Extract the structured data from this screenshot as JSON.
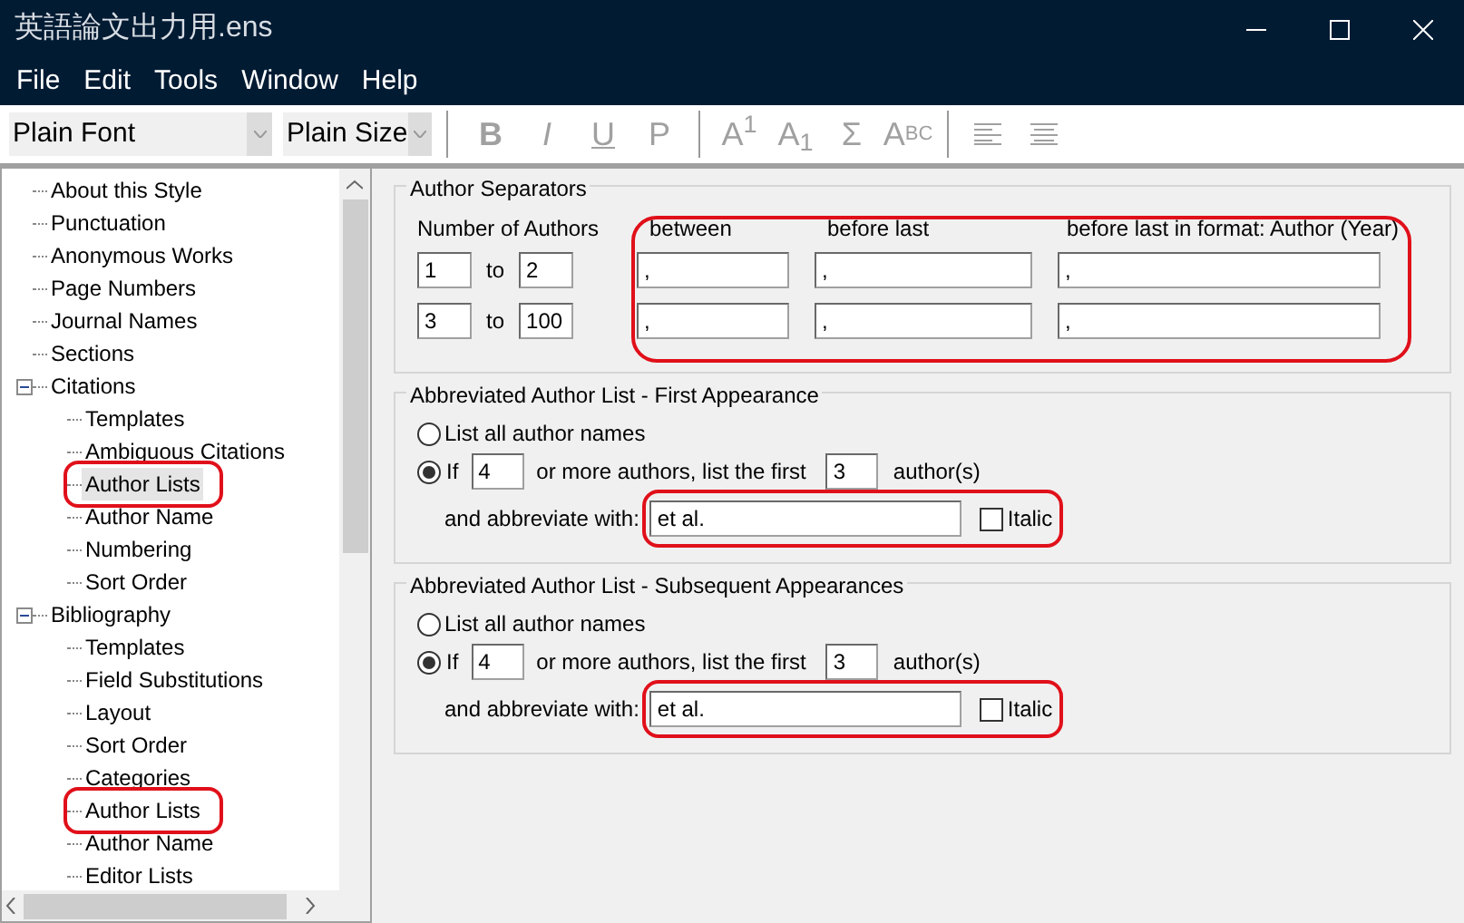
{
  "window": {
    "title": "英語論文出力用.ens"
  },
  "menu": [
    "File",
    "Edit",
    "Tools",
    "Window",
    "Help"
  ],
  "toolbar": {
    "font": "Plain Font",
    "size": "Plain Size",
    "buttons": [
      {
        "kind": "text",
        "label": "B",
        "disabled": true
      },
      {
        "kind": "text",
        "label": "I",
        "disabled": true
      },
      {
        "kind": "text",
        "label": "U",
        "disabled": true
      },
      {
        "kind": "text",
        "label": "P",
        "disabled": true
      },
      {
        "kind": "separator"
      },
      {
        "kind": "text",
        "label": "A$^{1}$",
        "disabled": true
      },
      {
        "kind": "text",
        "label": "A$_{1}$",
        "disabled": true
      },
      {
        "kind": "text",
        "label": "Σ",
        "disabled": true
      },
      {
        "kind": "text",
        "label": "A",
        "small": "BC",
        "disabled": true
      },
      {
        "kind": "separator"
      },
      {
        "kind": "align-left",
        "disabled": true
      },
      {
        "kind": "align-center",
        "disabled": true
      }
    ]
  },
  "tree": [
    {
      "label": "About this Style",
      "selected": false,
      "circled": false
    },
    {
      "label": "Punctuation",
      "selected": false,
      "circled": false
    },
    {
      "label": "Anonymous Works",
      "selected": false,
      "circled": false
    },
    {
      "label": "Page Numbers",
      "selected": false,
      "circled": false
    },
    {
      "label": "Journal Names",
      "selected": false,
      "circled": false
    },
    {
      "label": "Sections",
      "selected": false,
      "circled": false
    },
    {
      "label": "Citations",
      "selected": false,
      "circled": false,
      "expanded": true,
      "children": [
        {
          "label": "Templates",
          "selected": false,
          "circled": false
        },
        {
          "label": "Ambiguous Citations",
          "selected": false,
          "circled": false
        },
        {
          "label": "Author Lists",
          "selected": true,
          "circled": true
        },
        {
          "label": "Author Name",
          "selected": false,
          "circled": false
        },
        {
          "label": "Numbering",
          "selected": false,
          "circled": false
        },
        {
          "label": "Sort Order",
          "selected": false,
          "circled": false
        }
      ]
    },
    {
      "label": "Bibliography",
      "selected": false,
      "circled": false,
      "expanded": true,
      "children": [
        {
          "label": "Templates",
          "selected": false,
          "circled": false
        },
        {
          "label": "Field Substitutions",
          "selected": false,
          "circled": false
        },
        {
          "label": "Layout",
          "selected": false,
          "circled": false
        },
        {
          "label": "Sort Order",
          "selected": false,
          "circled": false
        },
        {
          "label": "Categories",
          "selected": false,
          "circled": false
        },
        {
          "label": "Author Lists",
          "selected": false,
          "circled": true
        },
        {
          "label": "Author Name",
          "selected": false,
          "circled": false
        },
        {
          "label": "Editor Lists",
          "selected": false,
          "circled": false
        }
      ]
    }
  ],
  "separators": {
    "title": "Author Separators",
    "count_label": "Number of Authors",
    "circled": true,
    "columns": [
      "between",
      "before last",
      "before last in format: Author (Year)"
    ],
    "rows": [
      {
        "from": "1",
        "to_label": "to",
        "to": "2",
        "values": [
          ",",
          ",",
          ","
        ]
      },
      {
        "from": "3",
        "to_label": "to",
        "to": "100",
        "values": [
          ",",
          ",",
          ","
        ]
      }
    ]
  },
  "abbreviated": [
    {
      "title": "Abbreviated Author List - First Appearance",
      "options": [
        {
          "label": "List all author names",
          "selected": false
        },
        {
          "label": "If",
          "selected": true
        }
      ],
      "min_authors": "4",
      "middle": "or more authors, list the first",
      "first": "3",
      "suffix": "author(s)",
      "abbrev_label": "and abbreviate with:",
      "abbrev": "et al.",
      "italic_label": "Italic",
      "italic": false,
      "circled": true
    },
    {
      "title": "Abbreviated Author List - Subsequent Appearances",
      "options": [
        {
          "label": "List all author names",
          "selected": false
        },
        {
          "label": "If",
          "selected": true
        }
      ],
      "min_authors": "4",
      "middle": "or more authors, list the first",
      "first": "3",
      "suffix": "author(s)",
      "abbrev_label": "and abbreviate with:",
      "abbrev": "et al.",
      "italic_label": "Italic",
      "italic": false,
      "circled": true
    }
  ]
}
